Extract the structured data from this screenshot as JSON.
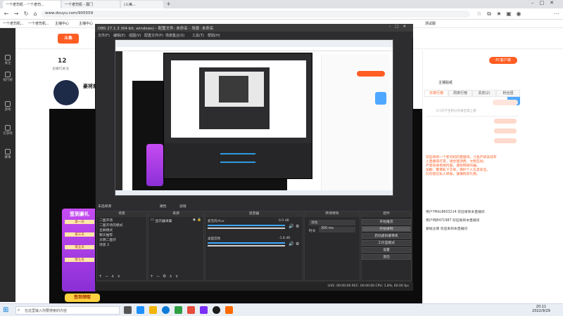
{
  "browser": {
    "tabs": [
      "一个老司机 - 一个老司...",
      "一个老司机 - 展门",
      "(三美..."
    ],
    "url": "www.douyu.com/905559",
    "bookmarks": [
      "一个老司机...",
      "一个老司机...",
      "主播中心",
      "主播中心",
      "测试服"
    ]
  },
  "site": {
    "side_items": [
      "关注",
      "排行榜",
      "游戏",
      "云游戏",
      "赛事"
    ],
    "follow_count": "12",
    "follow_label": "主播们关注",
    "streamer_name": "豪将刺",
    "pc_button": "PC客户端",
    "stream_card": "主播贴纸",
    "right_tabs": [
      "日排行榜",
      "周排行榜",
      "贵宾(2)",
      "粉丝团"
    ],
    "gift_note": "0.5元产生积分升级出现上榜",
    "chat_lines": [
      "欢迎来到一个老司机的直播间。斗鱼严禁未成年",
      "人直播或打赏，请合理消费，文明互动，",
      "严禁低俗色情内容，谨防网络诈骗。",
      "加群：警惕私下交易，保护个人信息安全。",
      "切勿轻信私人转账，谨慎购买礼物。",
      "欢迎来到本直播间",
      "用户YMdc8603214 欢迎来到本直播间",
      "用户MJ8471987 欢迎来到本直播间",
      "蒙幅注冊 欢迎来到本直播间"
    ],
    "promo_title": "签到豪礼",
    "promo_button": "签到领取",
    "days": [
      "第一天",
      "第三天",
      "第五天",
      "第七天"
    ]
  },
  "obs": {
    "title": "OBS 27.1.3 (64-bit, windows) - 配置文件: 未命名 - 场景: 未命名",
    "menu": [
      "文件(F)",
      "编辑(E)",
      "视图(V)",
      "配置文件(P)",
      "场景集合(S)",
      "工具(T)",
      "帮助(H)"
    ],
    "scene_label": "未选择源",
    "props": "属性",
    "filters": "滤镜",
    "docks": {
      "scenes": "场景",
      "sources": "来源",
      "mixer": "混音器",
      "transitions": "转场特效",
      "controls": "控件"
    },
    "scenes": [
      "二面开场",
      "二面开场的模式",
      "全屏模式",
      "聊天推荐",
      "天明二面开",
      "场景 2"
    ],
    "source": "显示器采集",
    "mixer_tracks": [
      {
        "name": "桌面音频",
        "db": "-1.8 dB"
      },
      {
        "name": "麦克风/Aux",
        "db": "0.0 dB"
      }
    ],
    "transition": "淡化",
    "duration_label": "时长",
    "duration": "300 ms",
    "controls": [
      "开始推流",
      "开始录制",
      "启动虚拟摄像机",
      "工作室模式",
      "设置",
      "退出"
    ],
    "status": "LIVE: 00:00:00   REC: 00:00:00   CPU: 1.8%, 60.00 fps"
  },
  "taskbar": {
    "search": "在这里输入你要搜索的内容",
    "time": "20:11",
    "date": "2022/9/29"
  },
  "colors": {
    "accent": "#ff5d23",
    "obs_bg": "#2d2d30",
    "promo": "#c64cf2"
  }
}
